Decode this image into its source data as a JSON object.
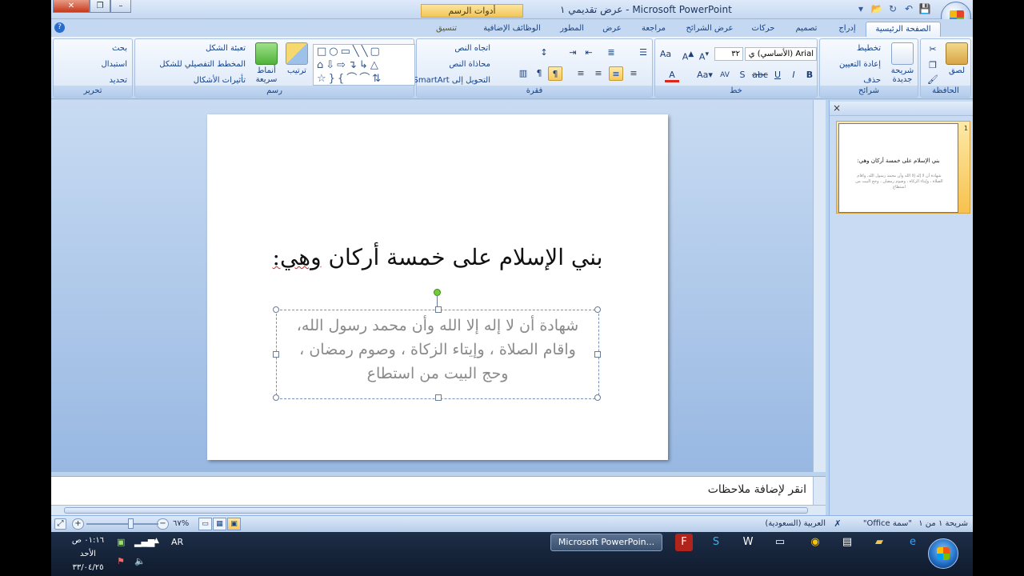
{
  "window": {
    "title": "عرض تقديمي ١ - Microsoft PowerPoint",
    "context_tab_title": "أدوات الرسم"
  },
  "tabs": [
    {
      "label": "الصفحة الرئيسية",
      "active": true
    },
    {
      "label": "إدراج"
    },
    {
      "label": "تصميم"
    },
    {
      "label": "حركات"
    },
    {
      "label": "عرض الشرائح"
    },
    {
      "label": "مراجعة"
    },
    {
      "label": "عرض"
    },
    {
      "label": "المطور"
    },
    {
      "label": "الوظائف الإضافية"
    },
    {
      "label": "تنسيق",
      "contextual": true
    }
  ],
  "ribbon": {
    "clipboard": {
      "title": "الحافظة",
      "paste": "لصق"
    },
    "slides": {
      "title": "شرائح",
      "new_slide": "شريحة جديدة",
      "layout": "تخطيط",
      "reset": "إعادة التعيين",
      "delete": "حذف"
    },
    "font": {
      "title": "خط",
      "font_name": "Arial (الأساسي) ي",
      "font_size": "٣٢",
      "bold": "B",
      "italic": "I",
      "underline": "U",
      "strike": "abc",
      "shadow": "S"
    },
    "paragraph": {
      "title": "فقرة",
      "text_direction": "اتجاه النص",
      "align_text": "محاذاة النص",
      "smartart": "التحويل إلى SmartArt"
    },
    "drawing": {
      "title": "رسم",
      "arrange": "ترتيب",
      "quick_styles": "أنماط سريعة",
      "shape_fill": "تعبئة الشكل",
      "shape_outline": "المخطط التفصيلي للشكل",
      "shape_effects": "تأثيرات الأشكال"
    },
    "editing": {
      "title": "تحرير",
      "find": "بحث",
      "replace": "استبدال",
      "select": "تحديد"
    }
  },
  "slide": {
    "title_part1": "بني الإسلام على خمسة أركان ",
    "title_part2": "وهي:",
    "body_line1": "شهادة أن لا إله إلا الله وأن محمد رسول الله،",
    "body_line2": "واقام الصلاة ، وإيتاء الزكاة ، وصوم رمضان ،",
    "body_line3": "وحج البيت من استطاع"
  },
  "thumbnail": {
    "number": "1",
    "title": "بني الإسلام على خمسة أركان وهي:",
    "body": "شهادة أن لا إله إلا الله وأن محمد رسول الله، واقام الصلاة ، وإيتاء الزكاة ، وصوم رمضان ، وحج البيت من استطاع"
  },
  "notes_placeholder": "انقر لإضافة ملاحظات",
  "status": {
    "slide_info": "شريحة ١ من ١",
    "theme": "\"سمة Office\"",
    "language": "العربية (السعودية)",
    "zoom": "%٦٧"
  },
  "taskbar": {
    "time": "٠١:١٦ ص",
    "day": "الأحد",
    "date": "٣٣/٠٤/٢٥",
    "lang": "AR",
    "app_item": "Microsoft PowerPoin..."
  }
}
